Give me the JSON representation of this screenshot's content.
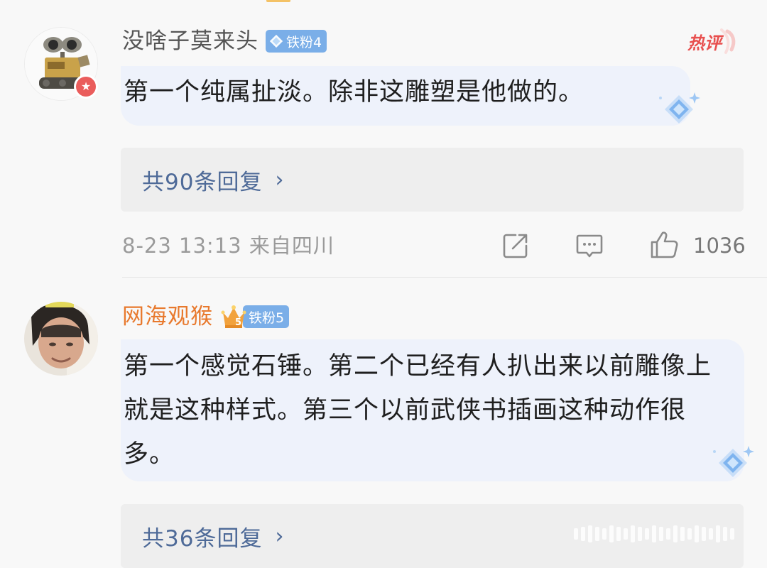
{
  "comments": [
    {
      "username": "没啥子莫来头",
      "fan_badge": "铁粉4",
      "hot_tag": "热评",
      "text": "第一个纯属扯淡。除非这雕塑是他做的。",
      "replies_label": "共90条回复",
      "timestamp": "8-23 13:13",
      "location": "来自四川",
      "like_count": "1036",
      "icons": [
        "share-icon",
        "comment-icon",
        "like-icon"
      ]
    },
    {
      "username": "网海观猴",
      "fan_badge": "铁粉5",
      "crown_level": "5",
      "text": "第一个感觉石锤。第二个已经有人扒出来以前雕像上就是这种样式。第三个以前武侠书插画这种动作很多。",
      "replies_label": "共36条回复"
    }
  ],
  "colors": {
    "username_default": "#555555",
    "username_vip": "#e8792d",
    "fan_badge": "#7aaee8",
    "link_blue": "#4e6a98",
    "hot_red": "#e8504f"
  }
}
